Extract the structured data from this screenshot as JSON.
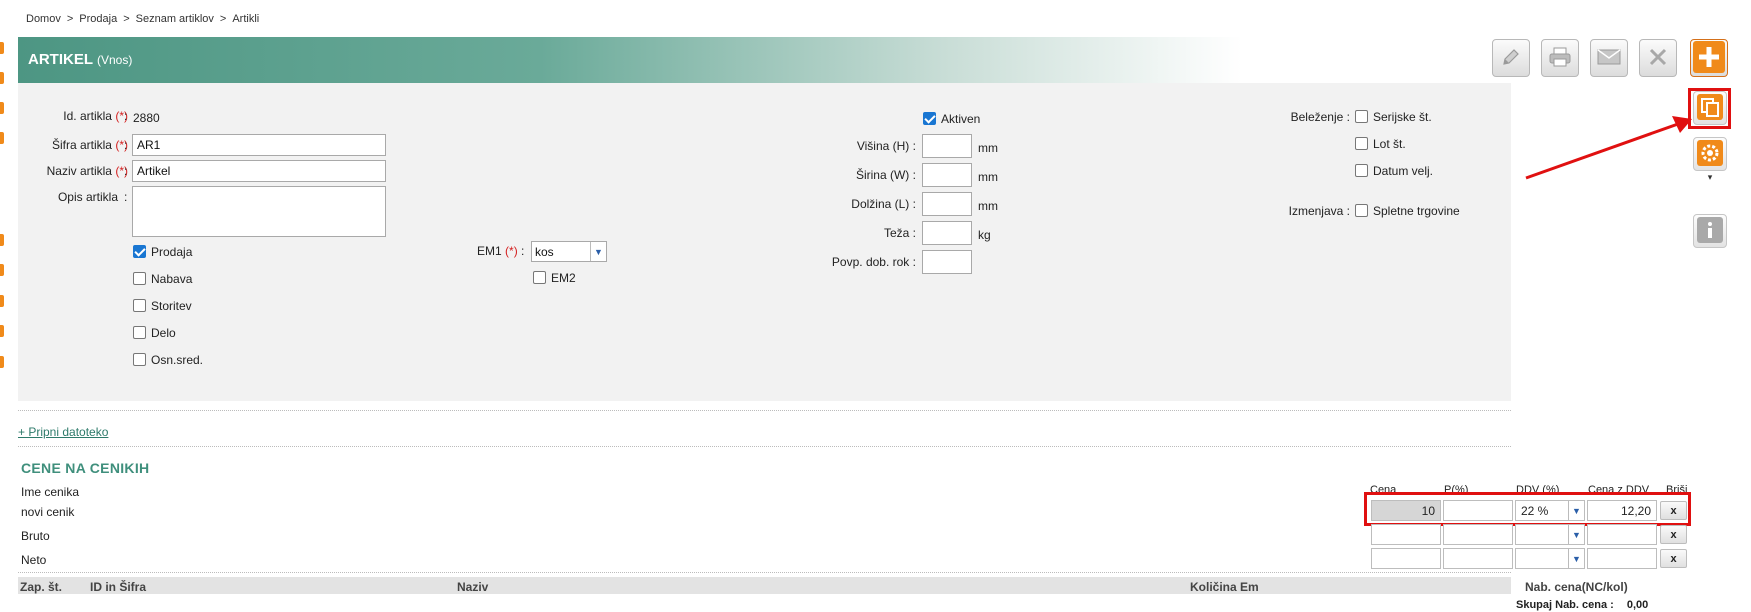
{
  "breadcrumb": {
    "items": [
      "Domov",
      "Prodaja",
      "Seznam artiklov",
      "Artikli"
    ],
    "separator": ">"
  },
  "header": {
    "title": "ARTIKEL",
    "subtitle": "(Vnos)"
  },
  "toolbar": {
    "icons": [
      "pencil-icon",
      "printer-icon",
      "envelope-icon",
      "close-icon"
    ],
    "add_icon": "plus-icon"
  },
  "side_toolbar": {
    "icons": [
      "copy-icon",
      "gear-icon",
      "info-icon"
    ],
    "dropdown_glyph": "▾"
  },
  "form": {
    "required_mark": "(*)",
    "colon": ":",
    "id_label": "Id. artikla",
    "id_value": "2880",
    "code_label": "Šifra artikla",
    "code_value": "AR1",
    "name_label": "Naziv artikla",
    "name_value": "Artikel",
    "description_label": "Opis artikla",
    "description_value": "",
    "categories": [
      {
        "label": "Prodaja",
        "checked": true
      },
      {
        "label": "Nabava",
        "checked": false
      },
      {
        "label": "Storitev",
        "checked": false
      },
      {
        "label": "Delo",
        "checked": false
      },
      {
        "label": "Osn.sred.",
        "checked": false
      }
    ],
    "em1_label": "EM1",
    "em1_value": "kos",
    "em2_label": "EM2",
    "em2_checked": false,
    "active_label": "Aktiven",
    "active_checked": true,
    "dimensions": [
      {
        "label": "Višina (H)",
        "value": "",
        "unit": "mm"
      },
      {
        "label": "Širina (W)",
        "value": "",
        "unit": "mm"
      },
      {
        "label": "Dolžina (L)",
        "value": "",
        "unit": "mm"
      },
      {
        "label": "Teža",
        "value": "",
        "unit": "kg"
      },
      {
        "label": "Povp. dob. rok",
        "value": "",
        "unit": ""
      }
    ],
    "tracking_label": "Beleženje",
    "tracking_options": [
      {
        "label": "Serijske št.",
        "checked": false
      },
      {
        "label": "Lot št.",
        "checked": false
      },
      {
        "label": "Datum velj.",
        "checked": false
      }
    ],
    "exchange_label": "Izmenjava",
    "exchange_option": {
      "label": "Spletne trgovine",
      "checked": false
    }
  },
  "attach_link": "+ Pripni datoteko",
  "prices": {
    "title": "CENE NA CENIKIH",
    "name_header": "Ime cenika",
    "columns": [
      "Cena",
      "P(%)",
      "DDV (%)",
      "Cena z DDV",
      "Briši"
    ],
    "delete_label": "x",
    "rows": [
      {
        "name": "novi cenik",
        "price": "10",
        "p": "",
        "vat": "22 %",
        "price_vat": "12,20"
      },
      {
        "name": "Bruto",
        "price": "",
        "p": "",
        "vat": "",
        "price_vat": ""
      },
      {
        "name": "Neto",
        "price": "",
        "p": "",
        "vat": "",
        "price_vat": ""
      }
    ]
  },
  "bottom_table": {
    "headers": [
      "Zap. št.",
      "ID in Šifra",
      "Naziv",
      "Količina Em",
      "Nab. cena(NC/kol)"
    ],
    "total_label": "Skupaj Nab. cena :",
    "total_value": "0,00"
  },
  "colors": {
    "header_start": "#4d9683",
    "section_title": "#3f8f7c",
    "accent_orange": "#f08a1a",
    "annotation_red": "#e01010",
    "checkbox_blue": "#1976d2"
  }
}
